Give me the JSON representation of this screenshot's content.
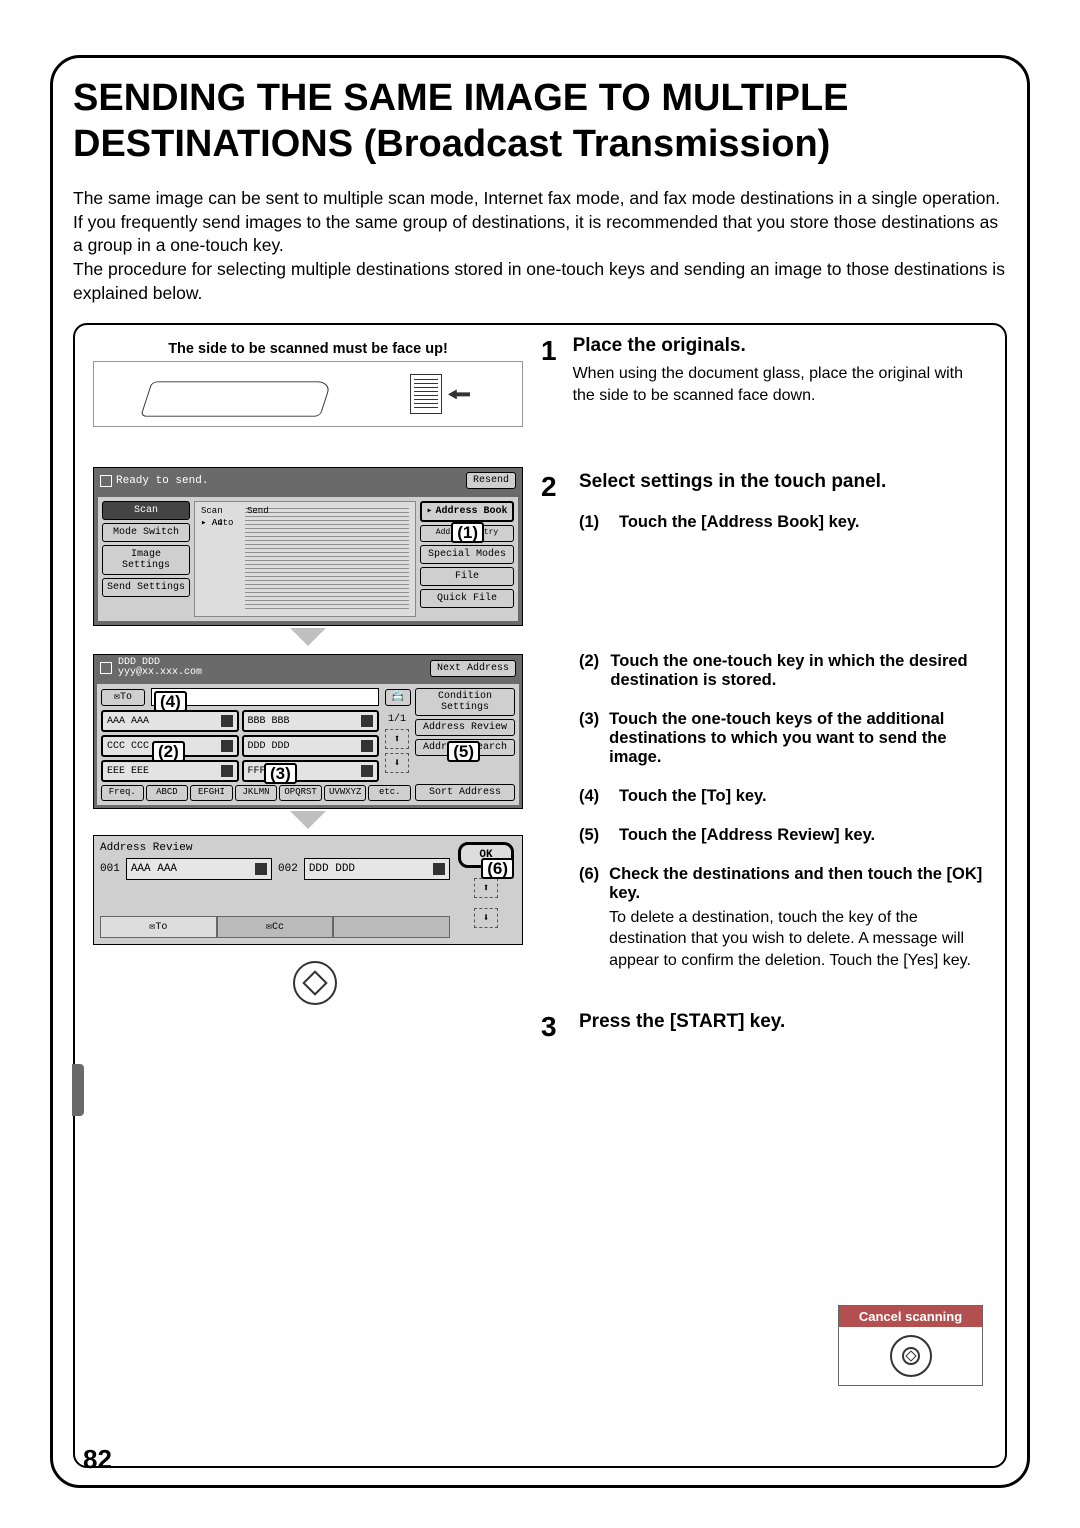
{
  "title": "SENDING THE SAME IMAGE TO MULTIPLE DESTINATIONS (Broadcast Transmission)",
  "intro": "The same image can be sent to multiple scan mode, Internet fax mode, and fax mode destinations in a single operation. If you frequently send images to the same group of destinations, it is recommended that you store those destinations as a group in a one-touch key.\nThe procedure for selecting multiple destinations stored in one-touch keys and sending an image to those destinations is explained below.",
  "page_number": "82",
  "scanner_note": "The side to be scanned must be face up!",
  "panel1": {
    "ready": "Ready to send.",
    "resend": "Resend",
    "side": {
      "scan": "Scan",
      "mode": "Mode Switch",
      "image": "Image\nSettings",
      "send": "Send Settings"
    },
    "tags": {
      "scan": "Scan",
      "a4": "A4",
      "send": "Send",
      "auto": "Auto"
    },
    "right": {
      "abook": "Address Book",
      "add": "Address Entry",
      "special": "Special Modes",
      "file": "File",
      "quick": "Quick File"
    }
  },
  "panel2": {
    "head": "DDD DDD",
    "sub": "yyy@xx.xxx.com",
    "next": "Next Address",
    "to": "To",
    "page": "1/1",
    "cond": "Condition\nSettings",
    "areview": "Address Review",
    "asearch": "Address Search",
    "sort": "Sort Address",
    "contacts": [
      "AAA AAA",
      "BBB BBB",
      "CCC CCC",
      "DDD DDD",
      "EEE EEE",
      "FFF FFF"
    ],
    "alpha": [
      "Freq.",
      "ABCD",
      "EFGHI",
      "JKLMN",
      "OPQRST",
      "UVWXYZ",
      "etc."
    ]
  },
  "panel3": {
    "title": "Address Review",
    "ok": "OK",
    "d1_num": "001",
    "d1": "AAA AAA",
    "d2_num": "002",
    "d2": "DDD DDD",
    "to": "To",
    "cc": "Cc"
  },
  "callouts": {
    "c1": "(1)",
    "c2": "(2)",
    "c3": "(3)",
    "c4": "(4)",
    "c5": "(5)",
    "c6": "(6)"
  },
  "steps": {
    "s1": {
      "head": "Place the originals.",
      "body": "When using the document glass, place the original with the side to be scanned face down."
    },
    "s2": {
      "head": "Select settings in the touch panel.",
      "sub1": "Touch the [Address Book] key.",
      "sub2": "Touch the one-touch key in which the desired destination is stored.",
      "sub3": "Touch the one-touch keys of the additional destinations to which you want to send the image.",
      "sub4": "Touch the [To] key.",
      "sub5": "Touch the [Address Review] key.",
      "sub6h": "Check the destinations and then touch the [OK] key.",
      "sub6b": "To delete a destination, touch the key of the destination that you wish to delete. A message will appear to confirm the deletion. Touch the [Yes] key."
    },
    "s3": {
      "head": "Press the [START] key."
    }
  },
  "cancel": "Cancel scanning"
}
